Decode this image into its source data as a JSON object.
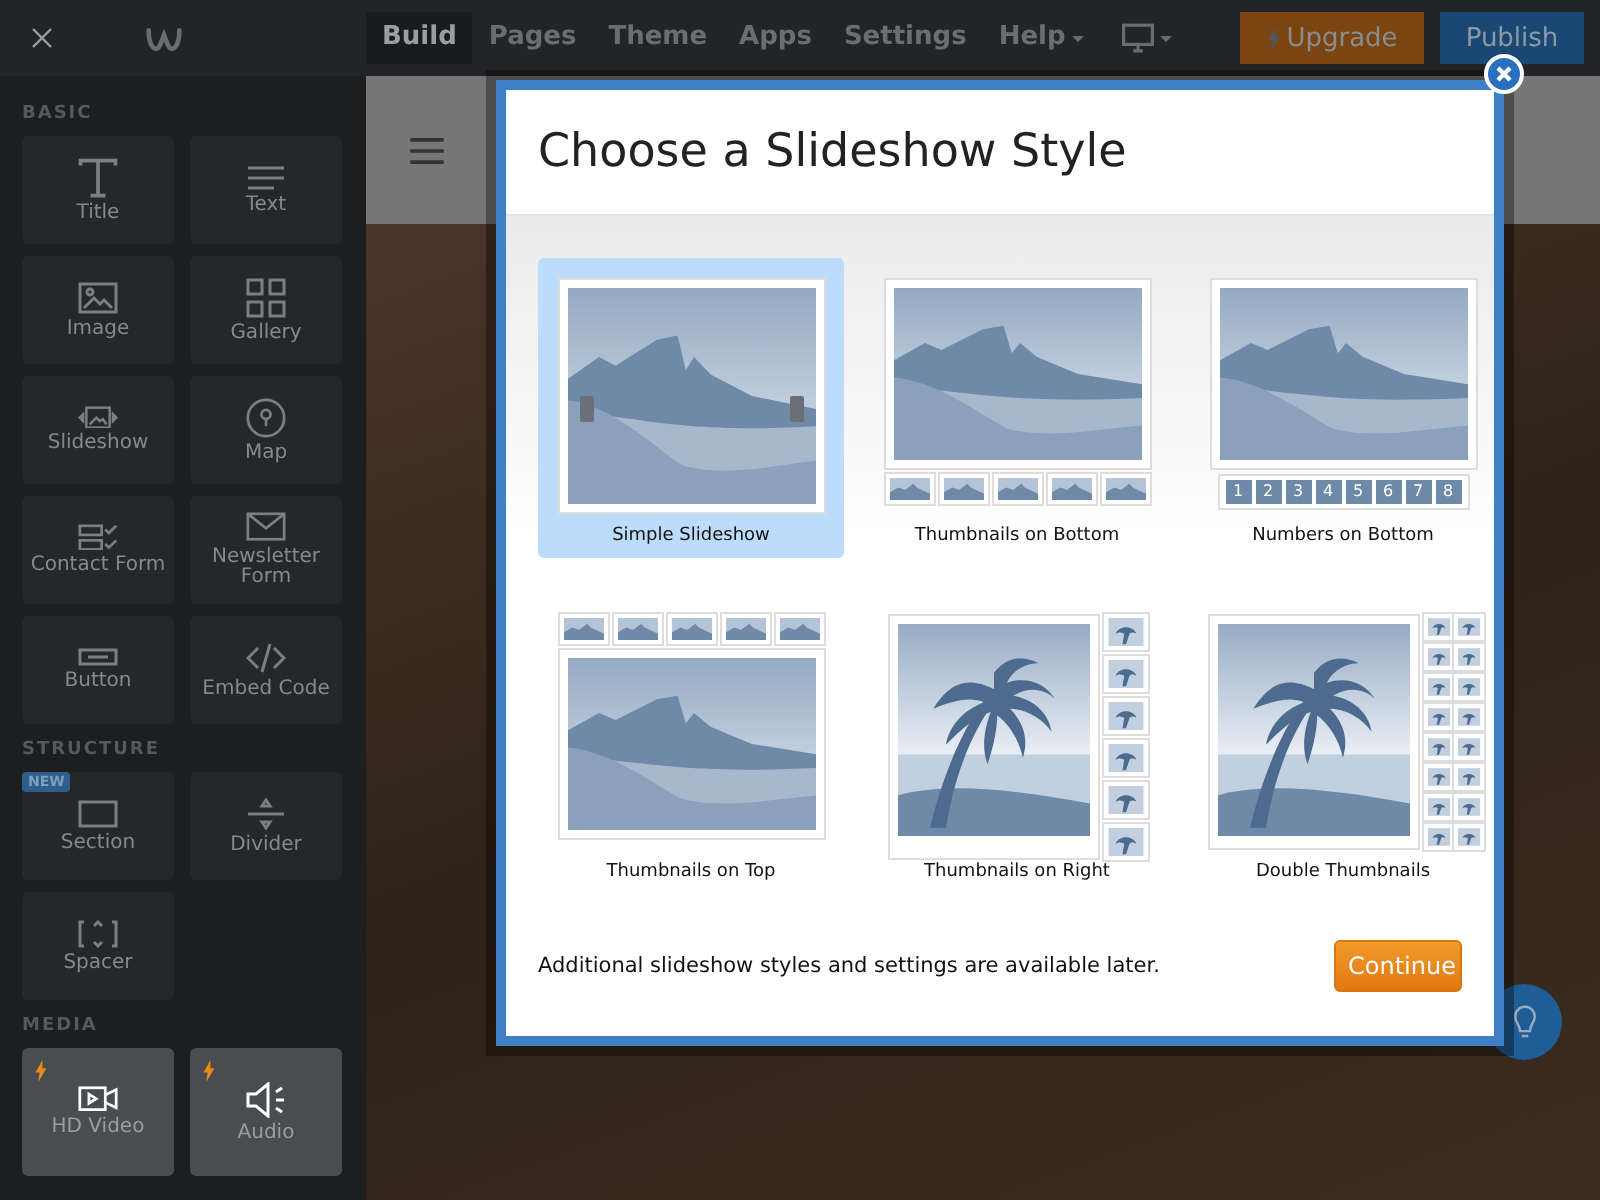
{
  "topbar": {
    "nav": [
      {
        "label": "Build",
        "selected": true,
        "dropdown": false
      },
      {
        "label": "Pages",
        "selected": false,
        "dropdown": false
      },
      {
        "label": "Theme",
        "selected": false,
        "dropdown": false
      },
      {
        "label": "Apps",
        "selected": false,
        "dropdown": false
      },
      {
        "label": "Settings",
        "selected": false,
        "dropdown": false
      },
      {
        "label": "Help",
        "selected": false,
        "dropdown": true
      }
    ],
    "upgrade": "Upgrade",
    "publish": "Publish"
  },
  "sidebar": {
    "sections": [
      {
        "title": "BASIC",
        "items": [
          {
            "label": "Title",
            "premium": false
          },
          {
            "label": "Text",
            "premium": false
          },
          {
            "label": "Image",
            "premium": false
          },
          {
            "label": "Gallery",
            "premium": false
          },
          {
            "label": "Slideshow",
            "premium": false
          },
          {
            "label": "Map",
            "premium": false
          },
          {
            "label": "Contact Form",
            "premium": false
          },
          {
            "label": "Newsletter Form",
            "premium": false
          },
          {
            "label": "Button",
            "premium": false
          },
          {
            "label": "Embed Code",
            "premium": false
          }
        ]
      },
      {
        "title": "STRUCTURE",
        "items": [
          {
            "label": "Section",
            "premium": false,
            "badge": "NEW"
          },
          {
            "label": "Divider",
            "premium": false
          },
          {
            "label": "Spacer",
            "premium": false
          }
        ]
      },
      {
        "title": "MEDIA",
        "items": [
          {
            "label": "HD Video",
            "premium": true
          },
          {
            "label": "Audio",
            "premium": true
          }
        ]
      }
    ]
  },
  "dialog": {
    "title": "Choose a Slideshow Style",
    "options": [
      {
        "kind": "simple",
        "label": "Simple Slideshow",
        "selected": true
      },
      {
        "kind": "thumbs_bottom",
        "label": "Thumbnails on Bottom",
        "selected": false
      },
      {
        "kind": "numbers_bottom",
        "label": "Numbers on Bottom",
        "selected": false,
        "numbers": [
          "1",
          "2",
          "3",
          "4",
          "5",
          "6",
          "7",
          "8"
        ]
      },
      {
        "kind": "thumbs_top",
        "label": "Thumbnails on Top",
        "selected": false
      },
      {
        "kind": "thumbs_right",
        "label": "Thumbnails on Right",
        "selected": false
      },
      {
        "kind": "double_thumbs",
        "label": "Double Thumbnails",
        "selected": false
      }
    ],
    "note": "Additional slideshow styles and settings are available later.",
    "continue": "Continue"
  }
}
